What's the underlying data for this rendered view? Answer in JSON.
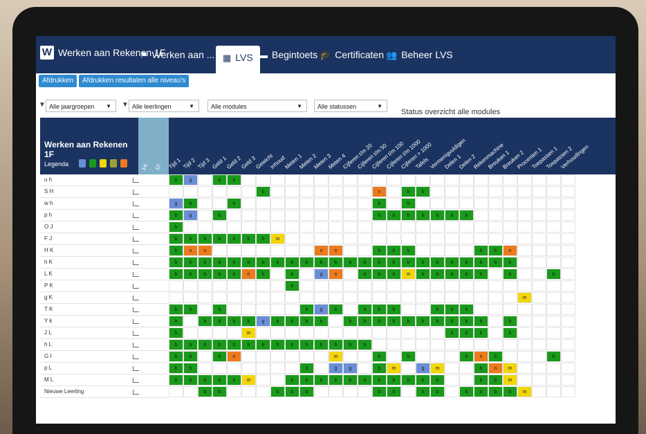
{
  "header": {
    "app_title": "Werken aan Rekenen 1F",
    "tabs": [
      {
        "label": "Werken aan ...",
        "icon": "flag-icon"
      },
      {
        "label": "LVS",
        "icon": "table-icon"
      },
      {
        "label": "Begintoets",
        "icon": "folder-icon"
      },
      {
        "label": "Certificaten",
        "icon": "graduation-cap-icon"
      },
      {
        "label": "Beheer LVS",
        "icon": "users-icon"
      }
    ]
  },
  "toolbar": {
    "print_label": "Afdrukken",
    "print_all_label": "Afdrukken resultaten alle niveau's"
  },
  "filters": {
    "year": "Alle jaargroepen",
    "students": "Alle leerlingen",
    "modules": "Alle modules",
    "statuses": "Alle statussen",
    "status_text": "Status overzicht alle modules"
  },
  "table": {
    "title": "Werken aan Rekenen 1F",
    "legend_label": "Legenda",
    "legend_colors": [
      "#6b8fd6",
      "#1a9a1a",
      "#f2d60b",
      "#9aa13a",
      "#ed7b1e"
    ],
    "level_columns": [
      "1A",
      "1F"
    ],
    "columns": [
      "Tijd 1",
      "Tijd 2",
      "Tijd 3",
      "Geld 1",
      "Geld 2",
      "Geld 3",
      "Gewicht",
      "Inhoud",
      "Meten 1",
      "Meten 2",
      "Meten 3",
      "Meten 4",
      "Cijferen t/m 20",
      "Cijferen t/m 50",
      "Cijferen t/m 100",
      "Cijferen t/m 1000",
      "Cijferen > 1000",
      "Tafels",
      "Vermenigvuldigen",
      "Delen 1",
      "Delen 2",
      "Rekenmachine",
      "Breuken 1",
      "Breuken 2",
      "Procenten 1",
      "Toepassen 1",
      "Toepassen 2",
      "Verhoudingen"
    ],
    "students": [
      "u h",
      "S H",
      "w h",
      "p h",
      "O J",
      "F J",
      "H K",
      "h K",
      "L K",
      "P K",
      "g K",
      "T K",
      "Y k",
      "J L",
      "h L",
      "G I",
      "p L",
      "M L",
      "Nieuwe Leerling"
    ]
  },
  "status_colors": {
    "b": "#1a9a1a",
    "g": "#6b8fd6",
    "m": "#f2d60b",
    "n": "#ed7b1e"
  },
  "grid": [
    "bg.bb......................",
    "......b.......n.bb..........",
    "gb..b.........b.b...........",
    "bg.b..........bbbbbbb.......",
    "b...........................",
    "bbbbbbbm....................",
    "bnn.......nn..bbb....bbn....",
    "bbbbbbbbbbbbbbbbbbbbbbbb....",
    "bbbbbnb.b.gn.bbbmbbbbb.b..b.",
    "........b...................",
    "........................m...",
    "bb.b.....bgb.bbb..bbb.......",
    "b.bbbbgbbbb.bbbbbbbbbb.b....",
    "b....m.............bbb.b....",
    "bbbbbbbbbbbbbb..............",
    "bb.bn......m..b.b...bnb...b.",
    "bb.......b.gg.bm.gm..bnm....",
    "bbbbbm..bbbbbbbbbbb..bbm....",
    "..bb...bbb....bb.bb.bbbbm..."
  ]
}
